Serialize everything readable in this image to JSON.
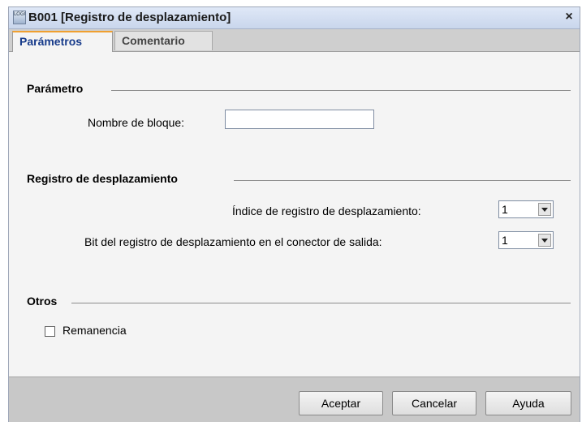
{
  "window": {
    "title": "B001 [Registro de desplazamiento]",
    "app_icon_text": "LOGO",
    "close_symbol": "×"
  },
  "tabs": [
    {
      "label": "Parámetros",
      "active": true
    },
    {
      "label": "Comentario",
      "active": false
    }
  ],
  "sections": {
    "parametro": {
      "title": "Parámetro",
      "block_name_label": "Nombre de bloque:",
      "block_name_value": ""
    },
    "registro": {
      "title": "Registro de desplazamiento",
      "index_label": "Índice de registro de desplazamiento:",
      "index_value": "1",
      "bit_label": "Bit del registro de desplazamiento en el conector de salida:",
      "bit_value": "1"
    },
    "otros": {
      "title": "Otros",
      "remanencia_label": "Remanencia",
      "remanencia_checked": false
    }
  },
  "buttons": {
    "accept": "Aceptar",
    "cancel": "Cancelar",
    "help": "Ayuda"
  },
  "colors": {
    "active_tab_text": "#163a8a",
    "active_tab_accent": "#f0a030",
    "titlebar": "#c9d6ec"
  },
  "icons": {
    "app": "logo-app-icon",
    "close": "close-icon",
    "dropdown": "chevron-down-icon"
  }
}
